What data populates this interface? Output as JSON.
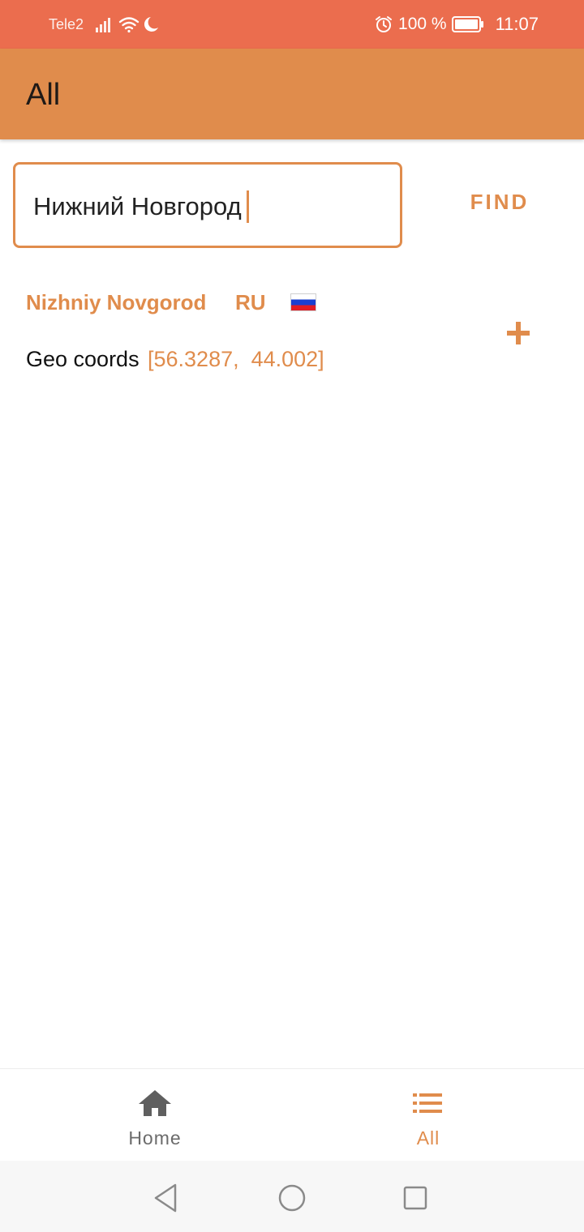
{
  "status_bar": {
    "carrier": "Tele2",
    "battery": "100 %",
    "time": "11:07",
    "icons": [
      "signal-icon",
      "wifi-icon",
      "moon-icon",
      "alarm-icon",
      "battery-icon"
    ]
  },
  "app_bar": {
    "title": "All"
  },
  "search": {
    "value": "Нижний Новгород",
    "find_label": "FIND"
  },
  "result": {
    "city": "Nizhniy Novgorod",
    "country": "RU",
    "flag": "russia-flag",
    "geo_label": "Geo coords",
    "geo_values": "[56.3287,  44.002]",
    "add_icon": "plus-icon"
  },
  "bottom_nav": {
    "items": [
      {
        "label": "Home",
        "icon": "home-icon"
      },
      {
        "label": "All",
        "icon": "list-icon"
      }
    ]
  },
  "colors": {
    "status_bar": "#eb6d4e",
    "app_bar": "#e08c4c",
    "accent": "#e08c4c",
    "inactive_nav": "#6b6b6b"
  }
}
